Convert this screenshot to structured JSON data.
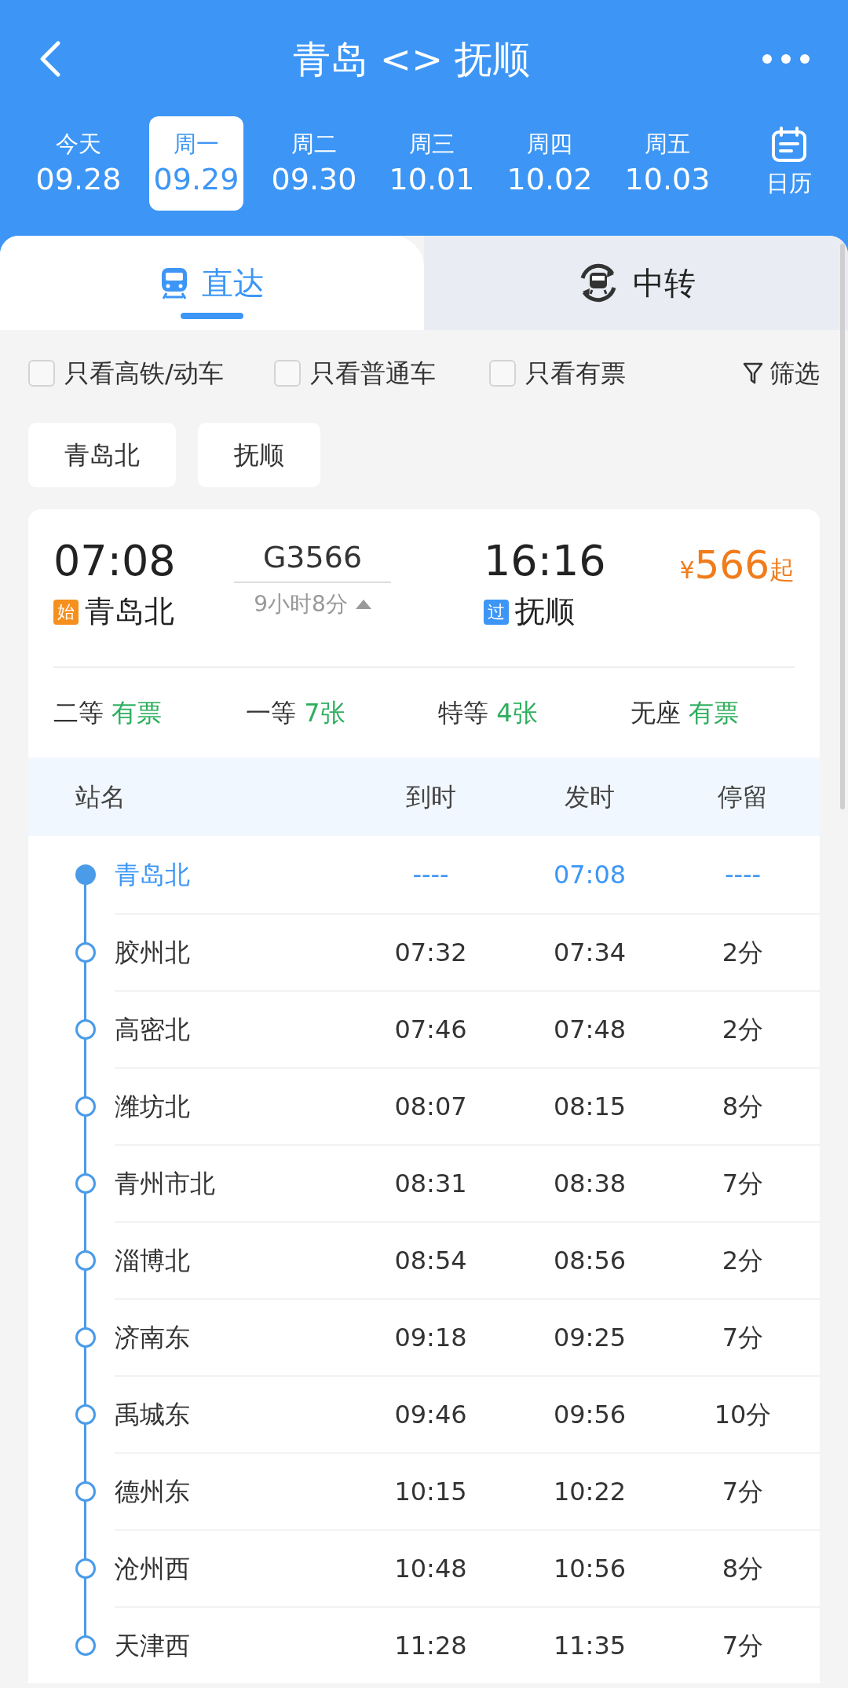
{
  "header": {
    "title": "青岛 <> 抚顺"
  },
  "dates": [
    {
      "day": "今天",
      "date": "09.28",
      "selected": false
    },
    {
      "day": "周一",
      "date": "09.29",
      "selected": true
    },
    {
      "day": "周二",
      "date": "09.30",
      "selected": false
    },
    {
      "day": "周三",
      "date": "10.01",
      "selected": false
    },
    {
      "day": "周四",
      "date": "10.02",
      "selected": false
    },
    {
      "day": "周五",
      "date": "10.03",
      "selected": false
    }
  ],
  "calendar_label": "日历",
  "tabs": [
    {
      "label": "直达",
      "selected": true
    },
    {
      "label": "中转",
      "selected": false
    }
  ],
  "filters": [
    {
      "label": "只看高铁/动车",
      "checked": false
    },
    {
      "label": "只看普通车",
      "checked": false
    },
    {
      "label": "只看有票",
      "checked": false
    }
  ],
  "filter_button": "筛选",
  "station_chips": [
    "青岛北",
    "抚顺"
  ],
  "train": {
    "depart_time": "07:08",
    "depart_badge": "始",
    "depart_station": "青岛北",
    "number": "G3566",
    "duration": "9小时8分",
    "arrive_time": "16:16",
    "arrive_badge": "过",
    "arrive_station": "抚顺",
    "price_currency": "¥",
    "price_amount": "566",
    "price_suffix": "起",
    "seats": [
      {
        "class": "二等",
        "availability": "有票"
      },
      {
        "class": "一等",
        "availability": "7张"
      },
      {
        "class": "特等",
        "availability": "4张"
      },
      {
        "class": "无座",
        "availability": "有票"
      }
    ]
  },
  "table": {
    "columns": [
      "站名",
      "到时",
      "发时",
      "停留"
    ],
    "rows": [
      {
        "station": "青岛北",
        "arrive": "----",
        "depart": "07:08",
        "stop": "----",
        "highlighted": true
      },
      {
        "station": "胶州北",
        "arrive": "07:32",
        "depart": "07:34",
        "stop": "2分",
        "highlighted": false
      },
      {
        "station": "高密北",
        "arrive": "07:46",
        "depart": "07:48",
        "stop": "2分",
        "highlighted": false
      },
      {
        "station": "潍坊北",
        "arrive": "08:07",
        "depart": "08:15",
        "stop": "8分",
        "highlighted": false
      },
      {
        "station": "青州市北",
        "arrive": "08:31",
        "depart": "08:38",
        "stop": "7分",
        "highlighted": false
      },
      {
        "station": "淄博北",
        "arrive": "08:54",
        "depart": "08:56",
        "stop": "2分",
        "highlighted": false
      },
      {
        "station": "济南东",
        "arrive": "09:18",
        "depart": "09:25",
        "stop": "7分",
        "highlighted": false
      },
      {
        "station": "禹城东",
        "arrive": "09:46",
        "depart": "09:56",
        "stop": "10分",
        "highlighted": false
      },
      {
        "station": "德州东",
        "arrive": "10:15",
        "depart": "10:22",
        "stop": "7分",
        "highlighted": false
      },
      {
        "station": "沧州西",
        "arrive": "10:48",
        "depart": "10:56",
        "stop": "8分",
        "highlighted": false
      },
      {
        "station": "天津西",
        "arrive": "11:28",
        "depart": "11:35",
        "stop": "7分",
        "highlighted": false
      }
    ]
  }
}
